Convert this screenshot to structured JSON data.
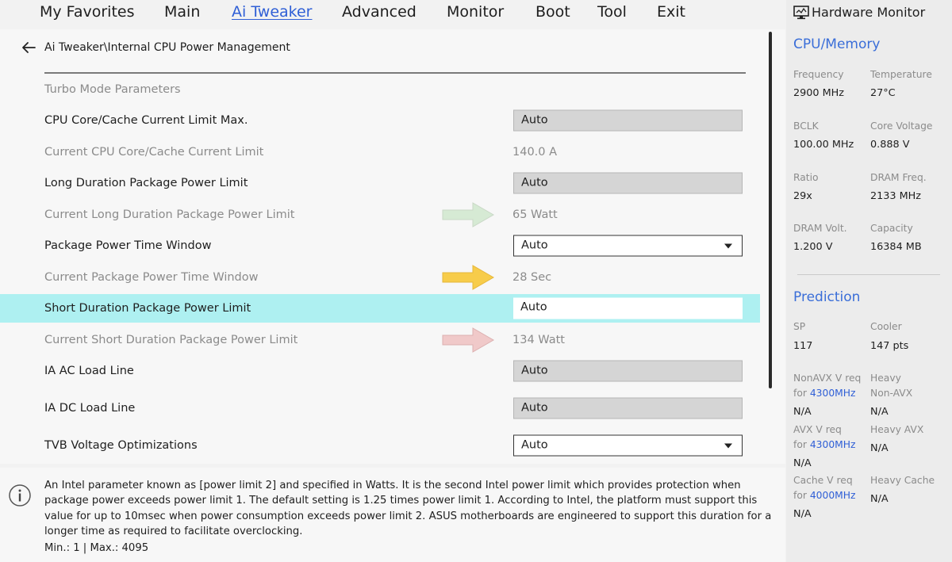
{
  "menu": {
    "tabs": [
      "My Favorites",
      "Main",
      "Ai Tweaker",
      "Advanced",
      "Monitor",
      "Boot",
      "Tool",
      "Exit"
    ],
    "active_index": 2
  },
  "breadcrumb": "Ai Tweaker\\Internal CPU Power Management",
  "section_heading": "Turbo Mode Parameters",
  "settings": [
    {
      "label": "CPU Core/Cache Current Limit Max.",
      "type": "gray-field",
      "value": "Auto"
    },
    {
      "label": "Current CPU Core/Cache Current Limit",
      "type": "readout",
      "value": "140.0 A"
    },
    {
      "label": "Long Duration Package Power Limit",
      "type": "gray-field",
      "value": "Auto"
    },
    {
      "label": "Current Long Duration Package Power Limit",
      "type": "readout",
      "value": "65 Watt",
      "arrow_color": "#d6ead4"
    },
    {
      "label": "Package Power Time Window",
      "type": "dropdown",
      "value": "Auto"
    },
    {
      "label": "Current Package Power Time Window",
      "type": "readout",
      "value": "28 Sec",
      "arrow_color": "#f7cc4a"
    },
    {
      "label": "Short Duration Package Power Limit",
      "type": "selected-field",
      "value": "Auto"
    },
    {
      "label": "Current Short Duration Package Power Limit",
      "type": "readout",
      "value": "134 Watt",
      "arrow_color": "#f0c9c9"
    },
    {
      "label": "IA AC Load Line",
      "type": "gray-field",
      "value": "Auto"
    },
    {
      "label": "IA DC Load Line",
      "type": "gray-field",
      "value": "Auto"
    },
    {
      "label": "TVB Voltage Optimizations",
      "type": "dropdown",
      "value": "Auto"
    }
  ],
  "help": {
    "text": "An Intel parameter known as [power limit 2] and specified in Watts. It is the second Intel power limit which provides protection when package power exceeds power limit 1. The default setting is 1.25 times power limit 1. According to Intel, the platform must support this value for up to 10msec when power consumption exceeds power limit 2. ASUS motherboards are engineered to support this duration for a longer time as required to facilitate overclocking.",
    "range": "Min.: 1   |   Max.: 4095"
  },
  "hardware_monitor": {
    "title": "Hardware Monitor",
    "cpu_memory": {
      "title": "CPU/Memory",
      "items": [
        {
          "label": "Frequency",
          "value": "2900 MHz"
        },
        {
          "label": "Temperature",
          "value": "27°C"
        },
        {
          "label": "BCLK",
          "value": "100.00 MHz"
        },
        {
          "label": "Core Voltage",
          "value": "0.888 V"
        },
        {
          "label": "Ratio",
          "value": "29x"
        },
        {
          "label": "DRAM Freq.",
          "value": "2133 MHz"
        },
        {
          "label": "DRAM Volt.",
          "value": "1.200 V"
        },
        {
          "label": "Capacity",
          "value": "16384 MB"
        }
      ]
    },
    "prediction": {
      "title": "Prediction",
      "sp_label": "SP",
      "sp_value": "117",
      "cooler_label": "Cooler",
      "cooler_value": "147 pts",
      "nonavx_label": "NonAVX V req",
      "for_word": "for",
      "nonavx_freq": "4300MHz",
      "nonavx_value": "N/A",
      "heavy_nonavx_label1": "Heavy",
      "heavy_nonavx_label2": "Non-AVX",
      "heavy_nonavx_value": "N/A",
      "avx_label": "AVX V req",
      "avx_freq": "4300MHz",
      "avx_value": "N/A",
      "heavy_avx_label": "Heavy AVX",
      "heavy_avx_value": "N/A",
      "cache_label": "Cache V req",
      "cache_freq": "4000MHz",
      "cache_value": "N/A",
      "heavy_cache_label": "Heavy Cache",
      "heavy_cache_value": "N/A"
    }
  },
  "colors": {
    "active_tab": "#2f5fd6",
    "highlight_row": "#aef0f1",
    "section_title": "#3a6ed8"
  }
}
